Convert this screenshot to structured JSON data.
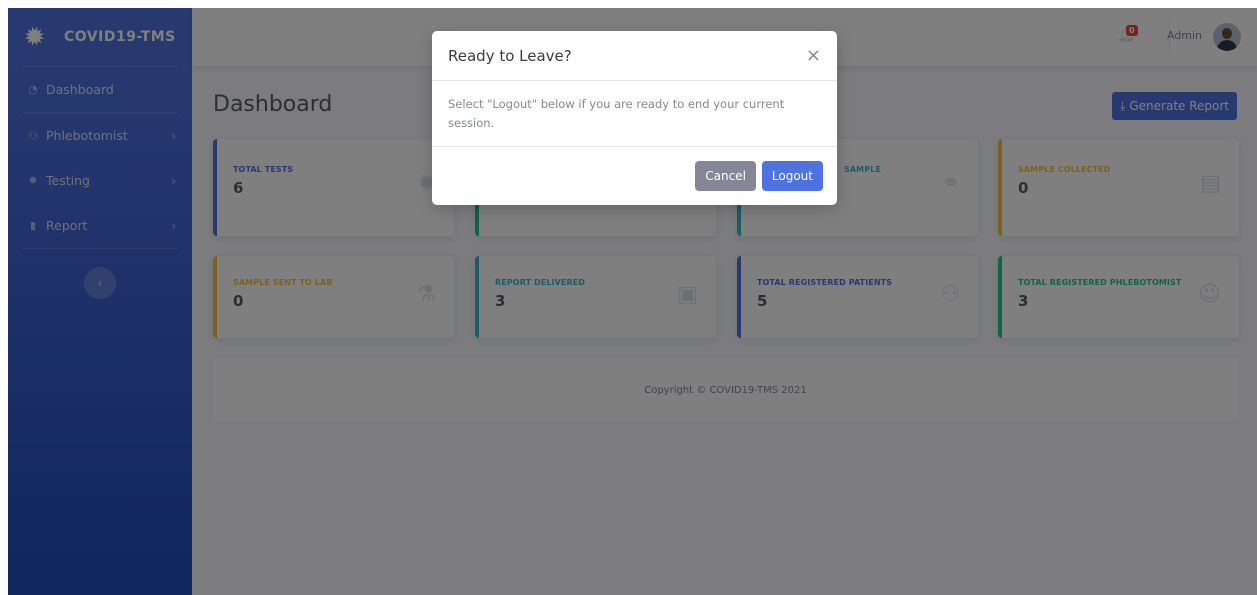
{
  "brand": {
    "name": "COVID19-TMS",
    "icon": "virus-icon"
  },
  "sidebar": {
    "items": [
      {
        "label": "Dashboard",
        "icon": "tachometer-icon",
        "has_children": false
      },
      {
        "label": "Phlebotomist",
        "icon": "users-icon",
        "has_children": true
      },
      {
        "label": "Testing",
        "icon": "virus-icon",
        "has_children": true
      },
      {
        "label": "Report",
        "icon": "file-icon",
        "has_children": true
      }
    ],
    "toggle_glyph": "‹"
  },
  "topbar": {
    "alert_count": "0",
    "user_name": "Admin"
  },
  "page": {
    "title": "Dashboard",
    "generate_report_label": "Generate Report"
  },
  "cards": [
    {
      "label": "TOTAL TESTS",
      "value": "6",
      "icon": "virus-icon",
      "color": "#4e73df"
    },
    {
      "label": "",
      "value": "",
      "icon": "",
      "color": "#1cc88a"
    },
    {
      "label": "SAMPLE",
      "value": "",
      "icon": "motorcycle-icon",
      "color": "#36b9cc"
    },
    {
      "label": "SAMPLE COLLECTED",
      "value": "0",
      "icon": "trash-icon",
      "color": "#f6c23e"
    },
    {
      "label": "SAMPLE SENT TO LAB",
      "value": "0",
      "icon": "microscope-icon",
      "color": "#f6c23e"
    },
    {
      "label": "REPORT DELIVERED",
      "value": "3",
      "icon": "clipboard-icon",
      "color": "#36b9cc"
    },
    {
      "label": "TOTAL REGISTERED PATIENTS",
      "value": "5",
      "icon": "users-icon",
      "color": "#4e73df"
    },
    {
      "label": "TOTAL REGISTERED PHLEBOTOMIST",
      "value": "3",
      "icon": "user-icon",
      "color": "#1cc88a"
    }
  ],
  "footer": {
    "copyright": "Copyright © COVID19-TMS 2021"
  },
  "modal": {
    "title": "Ready to Leave?",
    "close_glyph": "×",
    "body": "Select \"Logout\" below if you are ready to end your current session.",
    "cancel_label": "Cancel",
    "logout_label": "Logout"
  }
}
